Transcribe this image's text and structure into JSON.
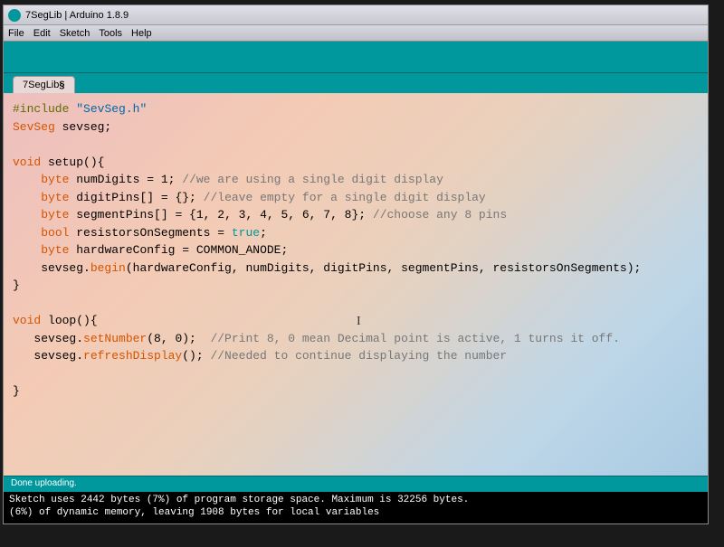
{
  "window": {
    "title": "7SegLib | Arduino 1.8.9"
  },
  "menu": {
    "file": "File",
    "edit": "Edit",
    "sketch": "Sketch",
    "tools": "Tools",
    "help": "Help"
  },
  "tab": {
    "name": "7SegLib",
    "modified": "§"
  },
  "code": {
    "line1_include": "#include",
    "line1_string": "\"SevSeg.h\"",
    "line2_type": "SevSeg",
    "line2_var": " sevseg;",
    "line4_void": "void",
    "line4_setup": " setup(){",
    "line5_byte": "byte",
    "line5_rest": " numDigits = 1; ",
    "line5_comment": "//we are using a single digit display",
    "line6_byte": "byte",
    "line6_rest": " digitPins[] = {}; ",
    "line6_comment": "//leave empty for a single digit display",
    "line7_byte": "byte",
    "line7_rest": " segmentPins[] = {1, 2, 3, 4, 5, 6, 7, 8}; ",
    "line7_comment": "//choose any 8 pins",
    "line8_bool": "bool",
    "line8_rest": " resistorsOnSegments = ",
    "line8_true": "true",
    "line8_semi": ";",
    "line9_byte": "byte",
    "line9_rest": " hardwareConfig = COMMON_ANODE;",
    "line10_obj": "    sevseg.",
    "line10_begin": "begin",
    "line10_args": "(hardwareConfig, numDigits, digitPins, segmentPins, resistorsOnSegments);",
    "line11_close": "}",
    "line13_void": "void",
    "line13_loop": " loop(){",
    "line14_obj": "   sevseg.",
    "line14_method": "setNumber",
    "line14_args": "(8, 0);  ",
    "line14_comment": "//Print 8, 0 mean Decimal point is active, 1 turns it off.",
    "line15_obj": "   sevseg.",
    "line15_method": "refreshDisplay",
    "line15_args": "(); ",
    "line15_comment": "//Needed to continue displaying the number",
    "line17_close": "}"
  },
  "status": {
    "text": "Done uploading."
  },
  "console": {
    "line1": "Sketch uses 2442 bytes (7%) of program storage space. Maximum is 32256 bytes.",
    "line2": "                       (6%) of dynamic memory, leaving 1908 bytes for local variables"
  }
}
